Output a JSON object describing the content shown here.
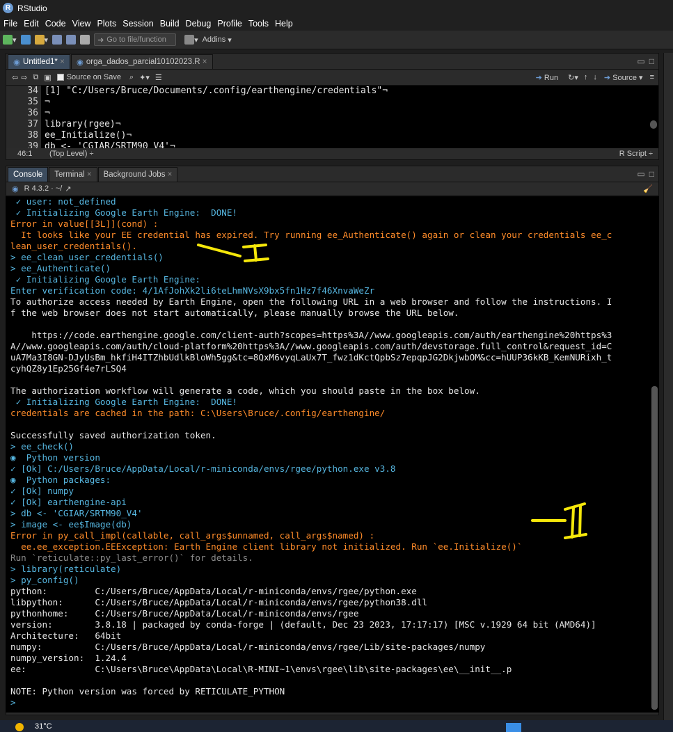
{
  "app": {
    "title": "RStudio"
  },
  "menu": [
    "File",
    "Edit",
    "Code",
    "View",
    "Plots",
    "Session",
    "Build",
    "Debug",
    "Profile",
    "Tools",
    "Help"
  ],
  "toolbar": {
    "goto_placeholder": "Go to file/function",
    "addins": "Addins"
  },
  "editor": {
    "tabs": [
      "Untitled1*",
      "orga_dados_parcial10102023.R"
    ],
    "source_on_save": "Source on Save",
    "run": "Run",
    "source": "Source",
    "lines": [
      {
        "n": "34",
        "t": "[1] \"C:/Users/Bruce/Documents/.config/earthengine/credentials\"¬"
      },
      {
        "n": "35",
        "t": "¬"
      },
      {
        "n": "36",
        "t": "¬"
      },
      {
        "n": "37",
        "t": "library(rgee)¬"
      },
      {
        "n": "38",
        "t": "ee_Initialize()¬"
      },
      {
        "n": "39",
        "t": "db <- 'CGIAR/SRTM90_V4'¬"
      }
    ],
    "status": {
      "pos": "46:1",
      "scope": "(Top Level) ÷",
      "type": "R Script ÷"
    }
  },
  "console": {
    "tabs": [
      "Console",
      "Terminal",
      "Background Jobs"
    ],
    "r_version": "R 4.3.2 · ~/",
    "lines": [
      {
        "c": "c-c",
        "t": " ✓ user: not_defined"
      },
      {
        "c": "c-c",
        "t": " ✓ Initializing Google Earth Engine:  DONE!"
      },
      {
        "c": "c-o",
        "t": "Error in value[[3L]](cond) : "
      },
      {
        "c": "c-o",
        "t": "  It looks like your EE credential has expired. Try running ee_Authenticate() again or clean your credentials ee_c"
      },
      {
        "c": "c-o",
        "t": "lean_user_credentials()."
      },
      {
        "c": "c-c",
        "t": "> ee_clean_user_credentials()"
      },
      {
        "c": "c-c",
        "t": "> ee_Authenticate()"
      },
      {
        "c": "c-c",
        "t": " ✓ Initializing Google Earth Engine:"
      },
      {
        "c": "c-c",
        "t": "Enter verification code: 4/1AfJohXk2li6teLhmNVsX9bx5fn1Hz7f46XnvaWeZr"
      },
      {
        "c": "c-w",
        "t": "To authorize access needed by Earth Engine, open the following URL in a web browser and follow the instructions. I"
      },
      {
        "c": "c-w",
        "t": "f the web browser does not start automatically, please manually browse the URL below."
      },
      {
        "c": "c-w",
        "t": ""
      },
      {
        "c": "c-w",
        "t": "    https://code.earthengine.google.com/client-auth?scopes=https%3A//www.googleapis.com/auth/earthengine%20https%3"
      },
      {
        "c": "c-w",
        "t": "A//www.googleapis.com/auth/cloud-platform%20https%3A//www.googleapis.com/auth/devstorage.full_control&request_id=C"
      },
      {
        "c": "c-w",
        "t": "uA7Ma3I8GN-DJyUsBm_hkfiH4ITZhbUdlkBloWh5gg&tc=8QxM6vyqLaUx7T_fwz1dKctQpbSz7epqpJG2DkjwbOM&cc=hUUP36kKB_KemNURixh_t"
      },
      {
        "c": "c-w",
        "t": "cyhQZ8y1Ep25Gf4e7rLSQ4"
      },
      {
        "c": "c-w",
        "t": ""
      },
      {
        "c": "c-w",
        "t": "The authorization workflow will generate a code, which you should paste in the box below."
      },
      {
        "c": "c-c",
        "t": " ✓ Initializing Google Earth Engine:  DONE!"
      },
      {
        "c": "c-o",
        "t": "credentials are cached in the path: C:\\Users\\Bruce/.config/earthengine/"
      },
      {
        "c": "c-w",
        "t": ""
      },
      {
        "c": "c-w",
        "t": "Successfully saved authorization token."
      },
      {
        "c": "c-c",
        "t": "> ee_check()"
      },
      {
        "c": "c-c",
        "t": "◉  Python version"
      },
      {
        "c": "c-c",
        "t": "✓ [Ok] C:/Users/Bruce/AppData/Local/r-miniconda/envs/rgee/python.exe v3.8"
      },
      {
        "c": "c-c",
        "t": "◉  Python packages:"
      },
      {
        "c": "c-c",
        "t": "✓ [Ok] numpy"
      },
      {
        "c": "c-c",
        "t": "✓ [Ok] earthengine-api"
      },
      {
        "c": "c-c",
        "t": "> db <- 'CGIAR/SRTM90_V4'"
      },
      {
        "c": "c-c",
        "t": "> image <- ee$Image(db)"
      },
      {
        "c": "c-o",
        "t": "Error in py_call_impl(callable, call_args$unnamed, call_args$named) : "
      },
      {
        "c": "c-o",
        "t": "  ee.ee_exception.EEException: Earth Engine client library not initialized. Run `ee.Initialize()`"
      },
      {
        "c": "c-gr",
        "t": "Run `reticulate::py_last_error()` for details."
      },
      {
        "c": "c-c",
        "t": "> library(reticulate)"
      },
      {
        "c": "c-c",
        "t": "> py_config()"
      },
      {
        "c": "c-w",
        "t": "python:         C:/Users/Bruce/AppData/Local/r-miniconda/envs/rgee/python.exe"
      },
      {
        "c": "c-w",
        "t": "libpython:      C:/Users/Bruce/AppData/Local/r-miniconda/envs/rgee/python38.dll"
      },
      {
        "c": "c-w",
        "t": "pythonhome:     C:/Users/Bruce/AppData/Local/r-miniconda/envs/rgee"
      },
      {
        "c": "c-w",
        "t": "version:        3.8.18 | packaged by conda-forge | (default, Dec 23 2023, 17:17:17) [MSC v.1929 64 bit (AMD64)]"
      },
      {
        "c": "c-w",
        "t": "Architecture:   64bit"
      },
      {
        "c": "c-w",
        "t": "numpy:          C:/Users/Bruce/AppData/Local/r-miniconda/envs/rgee/Lib/site-packages/numpy"
      },
      {
        "c": "c-w",
        "t": "numpy_version:  1.24.4"
      },
      {
        "c": "c-w",
        "t": "ee:             C:\\Users\\Bruce\\AppData\\Local\\R-MINI~1\\envs\\rgee\\lib\\site-packages\\ee\\__init__.p"
      },
      {
        "c": "c-w",
        "t": ""
      },
      {
        "c": "c-w",
        "t": "NOTE: Python version was forced by RETICULATE_PYTHON"
      },
      {
        "c": "c-c",
        "t": ">"
      }
    ]
  },
  "annotations": {
    "mark1": "I",
    "mark2": "II"
  },
  "taskbar": {
    "temp": "31°C"
  }
}
